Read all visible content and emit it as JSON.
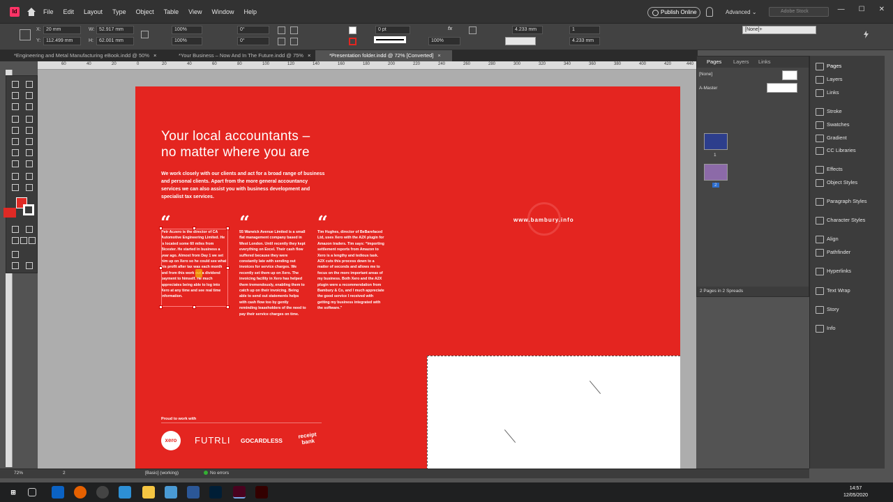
{
  "app": {
    "icon_letter": "Id",
    "menu": [
      "File",
      "Edit",
      "Layout",
      "Type",
      "Object",
      "Table",
      "View",
      "Window",
      "Help"
    ],
    "publish_label": "Publish Online",
    "workspace": "Advanced",
    "search_placeholder": "Adobe Stock",
    "window_buttons": [
      "—",
      "☐",
      "✕"
    ]
  },
  "control": {
    "x_label": "X:",
    "x": "20 mm",
    "y_label": "Y:",
    "y": "112.499 mm",
    "w_label": "W:",
    "w": "52.917 mm",
    "h_label": "H:",
    "h": "62.001 mm",
    "scale_x": "100%",
    "scale_y": "100%",
    "rotate": "0°",
    "shear": "0°",
    "stroke_weight": "0 pt",
    "opacity": "100%",
    "offset_1": "4.233 mm",
    "offset_2": "4.233 mm",
    "columns": "1",
    "object_style": "[None]+"
  },
  "tabs": [
    {
      "label": "*Engineering and Metal Manufacturing eBook.indd @ 50%",
      "close": "×"
    },
    {
      "label": "*Your Business – Now And In The Future.indd @ 75%",
      "close": "×"
    },
    {
      "label": "*Presentation folder.indd @ 72% [Converted]",
      "close": "×"
    }
  ],
  "ruler": {
    "ticks": [
      "60",
      "40",
      "20",
      "0",
      "20",
      "40",
      "60",
      "80",
      "100",
      "120",
      "140",
      "160",
      "180",
      "200",
      "220",
      "240",
      "260",
      "280",
      "300",
      "320",
      "340",
      "360",
      "380",
      "400",
      "420",
      "440"
    ]
  },
  "document": {
    "headline_1": "Your local accountants –",
    "headline_2": "no matter where you are",
    "intro": "We work closely with our clients and act for a broad range of business and personal clients. Apart from the more general accountancy services we can also assist you with business development and specialist tax services.",
    "quote_mark": "“",
    "quotes": [
      "Petr Aczero is the director of CA Automotive Engineering Limited. He is located some 60 miles from Bicester. He started in business a year ago. Almost from Day 1 we set him up on Xero so he could see what his profit after tax was each month and from this work out a dividend payment to himself. He much appreciates being able to log into Xero at any time and see real time information.",
      "55 Warwick Avenue Limited is a small flat management company based in West London. Until recently they kept everything on Excel. Their cash flow suffered because they were constantly late with sending out invoices for service charges. We recently set them up on Xero. The invoicing facility in Xero has helped them tremendously, enabling them to catch up on their invoicing. Being able to send out statements helps with cash flow too by gently reminding leaseholders of the need to pay their service charges on time.",
      "Tim Hughes, director of BeBarefaced Ltd, uses Xero with the A2X plugin for Amazon traders. Tim says: “Importing settlement reports from Amazon to Xero is a lengthy and tedious task. A2X cuts this process down to a matter of seconds and allows me to focus on the more important areas of my business. Both Xero and the A2X plugin were a recommendation from Bambury & Co, and I much appreciate the good service I received with getting my business integrated with the software.”"
    ],
    "website": "www.bambury.info",
    "proud": "Proud to work with",
    "logos": {
      "xero": "xero",
      "futrli": "FUTRLI",
      "gocardless": "GOCARDLESS",
      "receipt_1": "receipt",
      "receipt_2": "bank"
    }
  },
  "pages_panel": {
    "tabs": [
      "Pages",
      "Layers",
      "Links"
    ],
    "none_label": "[None]",
    "master_label": "A-Master",
    "page1_num": "1",
    "page2_num": "2",
    "footer": "2 Pages in 2 Spreads"
  },
  "dock": [
    "Pages",
    "Layers",
    "Links",
    "Stroke",
    "Swatches",
    "Gradient",
    "CC Libraries",
    "Effects",
    "Object Styles",
    "Paragraph Styles",
    "Character Styles",
    "Align",
    "Pathfinder",
    "Hyperlinks",
    "Text Wrap",
    "Story",
    "Info"
  ],
  "status": {
    "zoom": "72%",
    "page": "2",
    "style": "[Basic] (working)",
    "errors": "No errors"
  },
  "taskbar": {
    "time": "14:57",
    "date": "12/05/2020"
  },
  "colors": {
    "brand_red": "#e42520",
    "ui_dark": "#323232"
  }
}
